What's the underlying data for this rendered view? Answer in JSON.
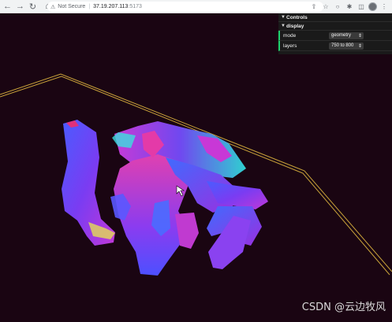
{
  "browser": {
    "not_secure": "Not Secure",
    "url_host": "37.19.207.113",
    "url_port": ":5173"
  },
  "gui": {
    "title": "Controls",
    "folder": "display",
    "rows": [
      {
        "label": "mode",
        "value": "geometry"
      },
      {
        "label": "layers",
        "value": "750 to 800"
      }
    ]
  },
  "watermark": "CSDN @云边牧风",
  "colors": {
    "background": "#1a0512",
    "frame_line": "#c9a23a",
    "accent_green": "#1ed36f"
  }
}
